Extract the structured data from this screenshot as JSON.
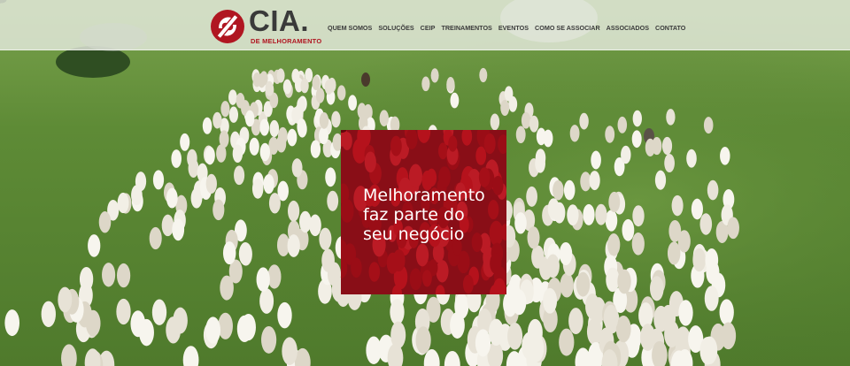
{
  "brand": {
    "name": "CIA.",
    "subtitle": "DE MELHORAMENTO",
    "colors": {
      "red": "#b01621",
      "dark": "#3a3a3a"
    }
  },
  "nav": {
    "items": [
      {
        "label": "QUEM SOMOS"
      },
      {
        "label": "SOLUÇÕES"
      },
      {
        "label": "CEIP"
      },
      {
        "label": "TREINAMENTOS"
      },
      {
        "label": "EVENTOS"
      },
      {
        "label": "COMO SE ASSOCIAR"
      },
      {
        "label": "ASSOCIADOS"
      },
      {
        "label": "CONTATO"
      }
    ]
  },
  "hero": {
    "headline_lines": [
      "Melhoramento",
      "faz parte do",
      "seu negócio"
    ],
    "overlay_color": "#8e0f19"
  }
}
